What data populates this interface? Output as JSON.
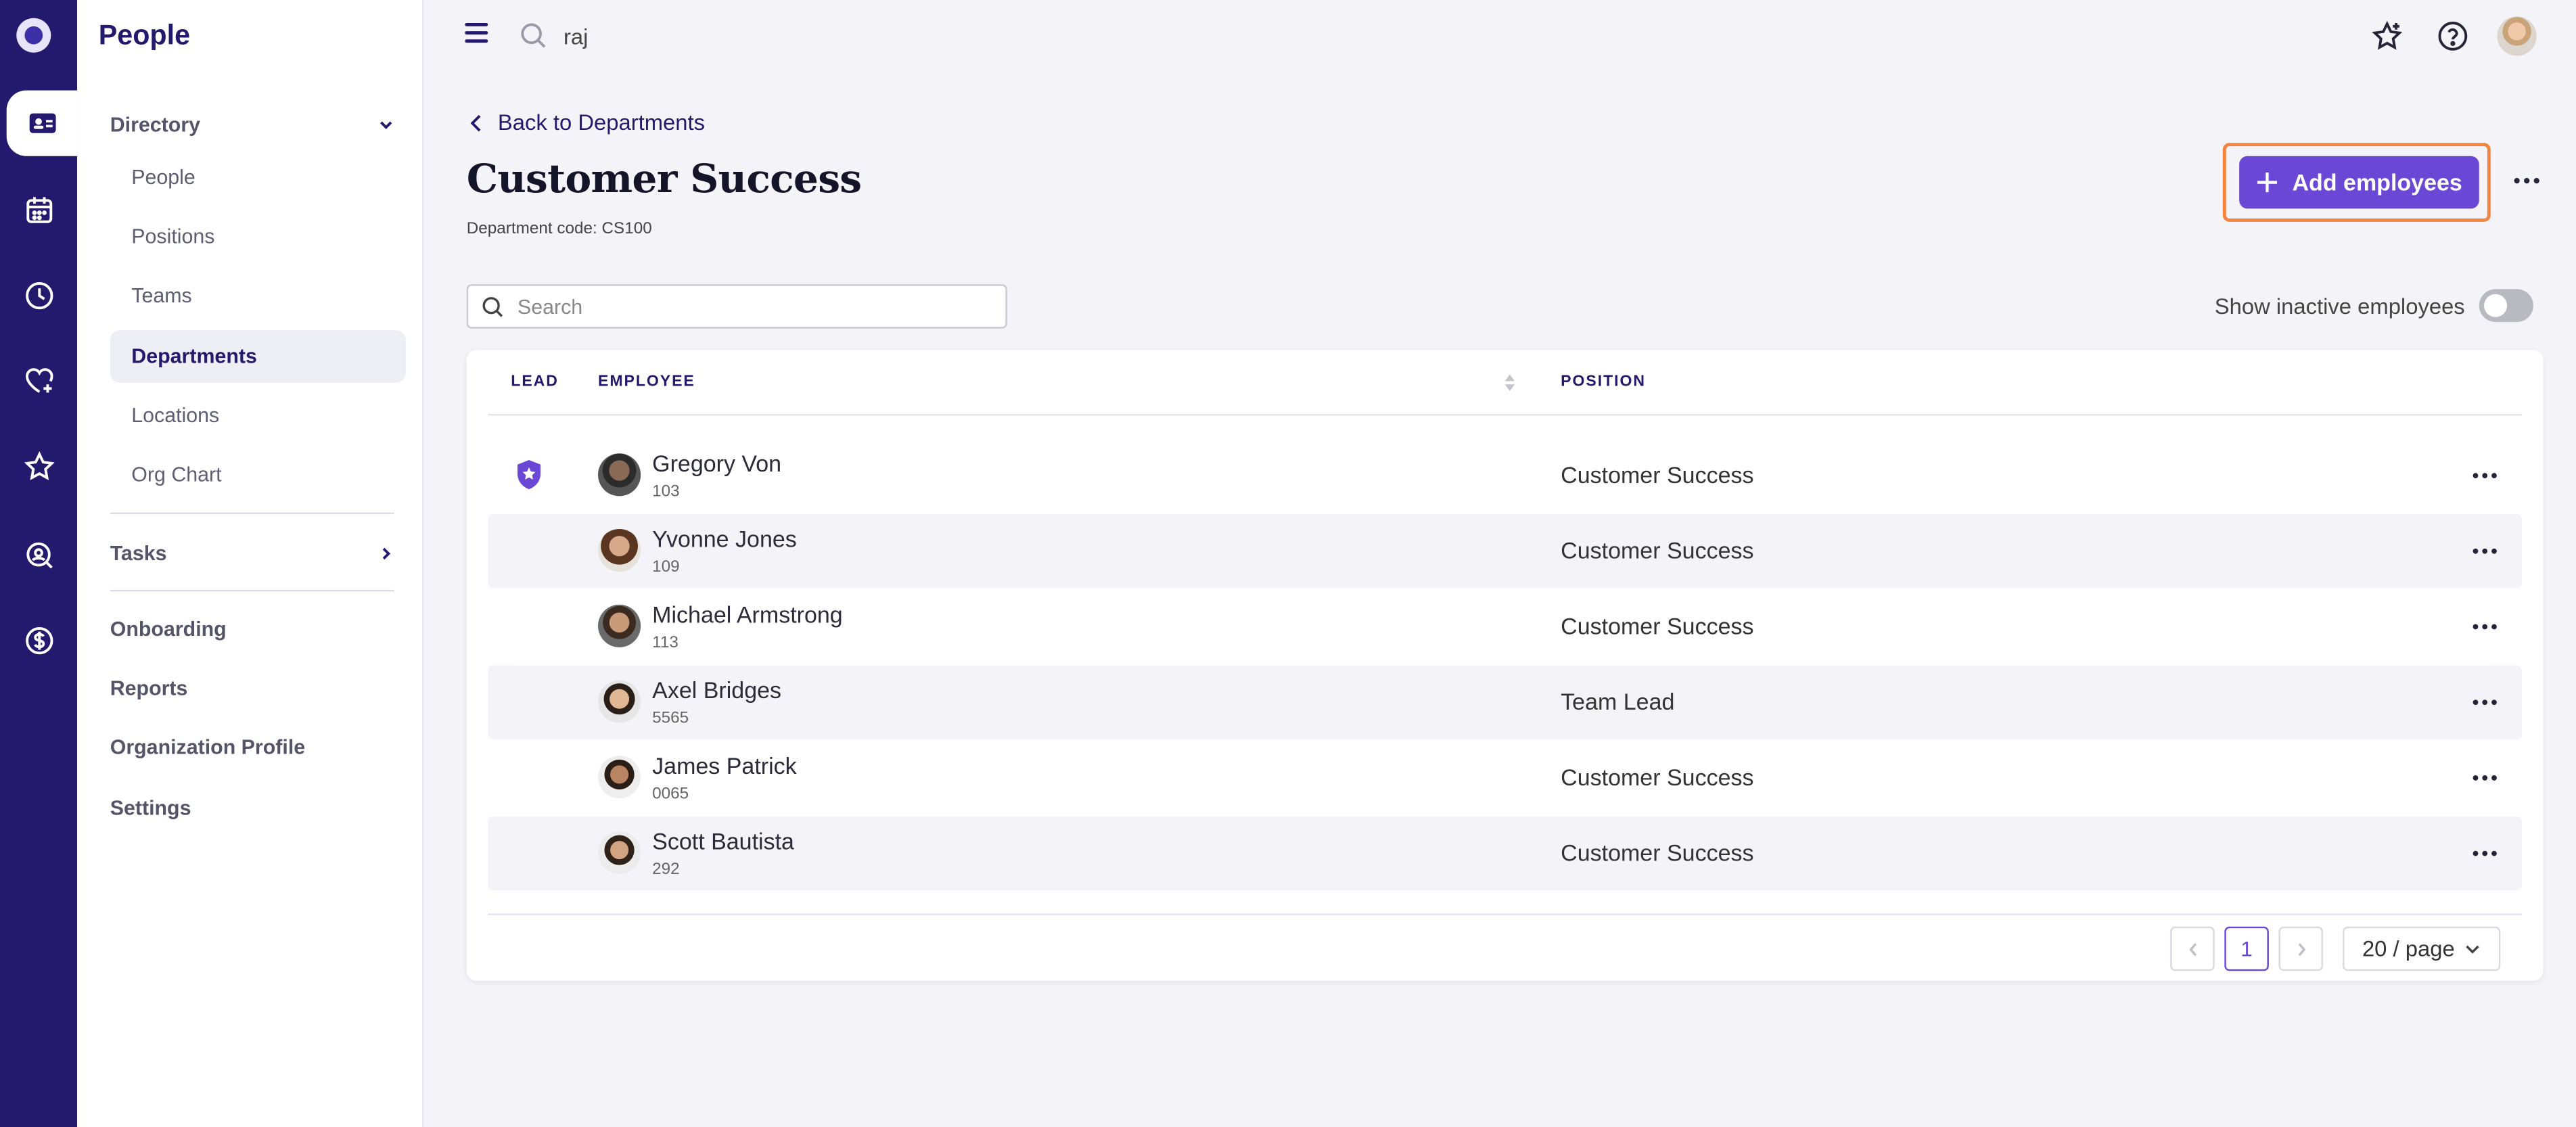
{
  "app": {
    "title": "People"
  },
  "topbar": {
    "search_value": "raj"
  },
  "nav": {
    "directory_label": "Directory",
    "directory_items": [
      "People",
      "Positions",
      "Teams",
      "Departments",
      "Locations",
      "Org Chart"
    ],
    "active_item": "Departments",
    "tasks_label": "Tasks",
    "other_items": [
      "Onboarding",
      "Reports",
      "Organization Profile",
      "Settings"
    ]
  },
  "page": {
    "back_label": "Back to Departments",
    "title": "Customer Success",
    "dept_code": "Department code: CS100",
    "add_button": "Add employees",
    "search_placeholder": "Search",
    "show_inactive_label": "Show inactive employees"
  },
  "table": {
    "headers": {
      "lead": "LEAD",
      "employee": "EMPLOYEE",
      "position": "POSITION"
    },
    "rows": [
      {
        "name": "Gregory Von",
        "id": "103",
        "position": "Customer Success",
        "lead": true
      },
      {
        "name": "Yvonne Jones",
        "id": "109",
        "position": "Customer Success",
        "lead": false
      },
      {
        "name": "Michael Armstrong",
        "id": "113",
        "position": "Customer Success",
        "lead": false
      },
      {
        "name": "Axel Bridges",
        "id": "5565",
        "position": "Team Lead",
        "lead": false
      },
      {
        "name": "James Patrick",
        "id": "0065",
        "position": "Customer Success",
        "lead": false
      },
      {
        "name": "Scott Bautista",
        "id": "292",
        "position": "Customer Success",
        "lead": false
      }
    ]
  },
  "pagination": {
    "current_page": "1",
    "page_size": "20 / page"
  },
  "colors": {
    "brand": "#231a6d",
    "accent": "#6b47d6",
    "highlight": "#f2843f"
  }
}
